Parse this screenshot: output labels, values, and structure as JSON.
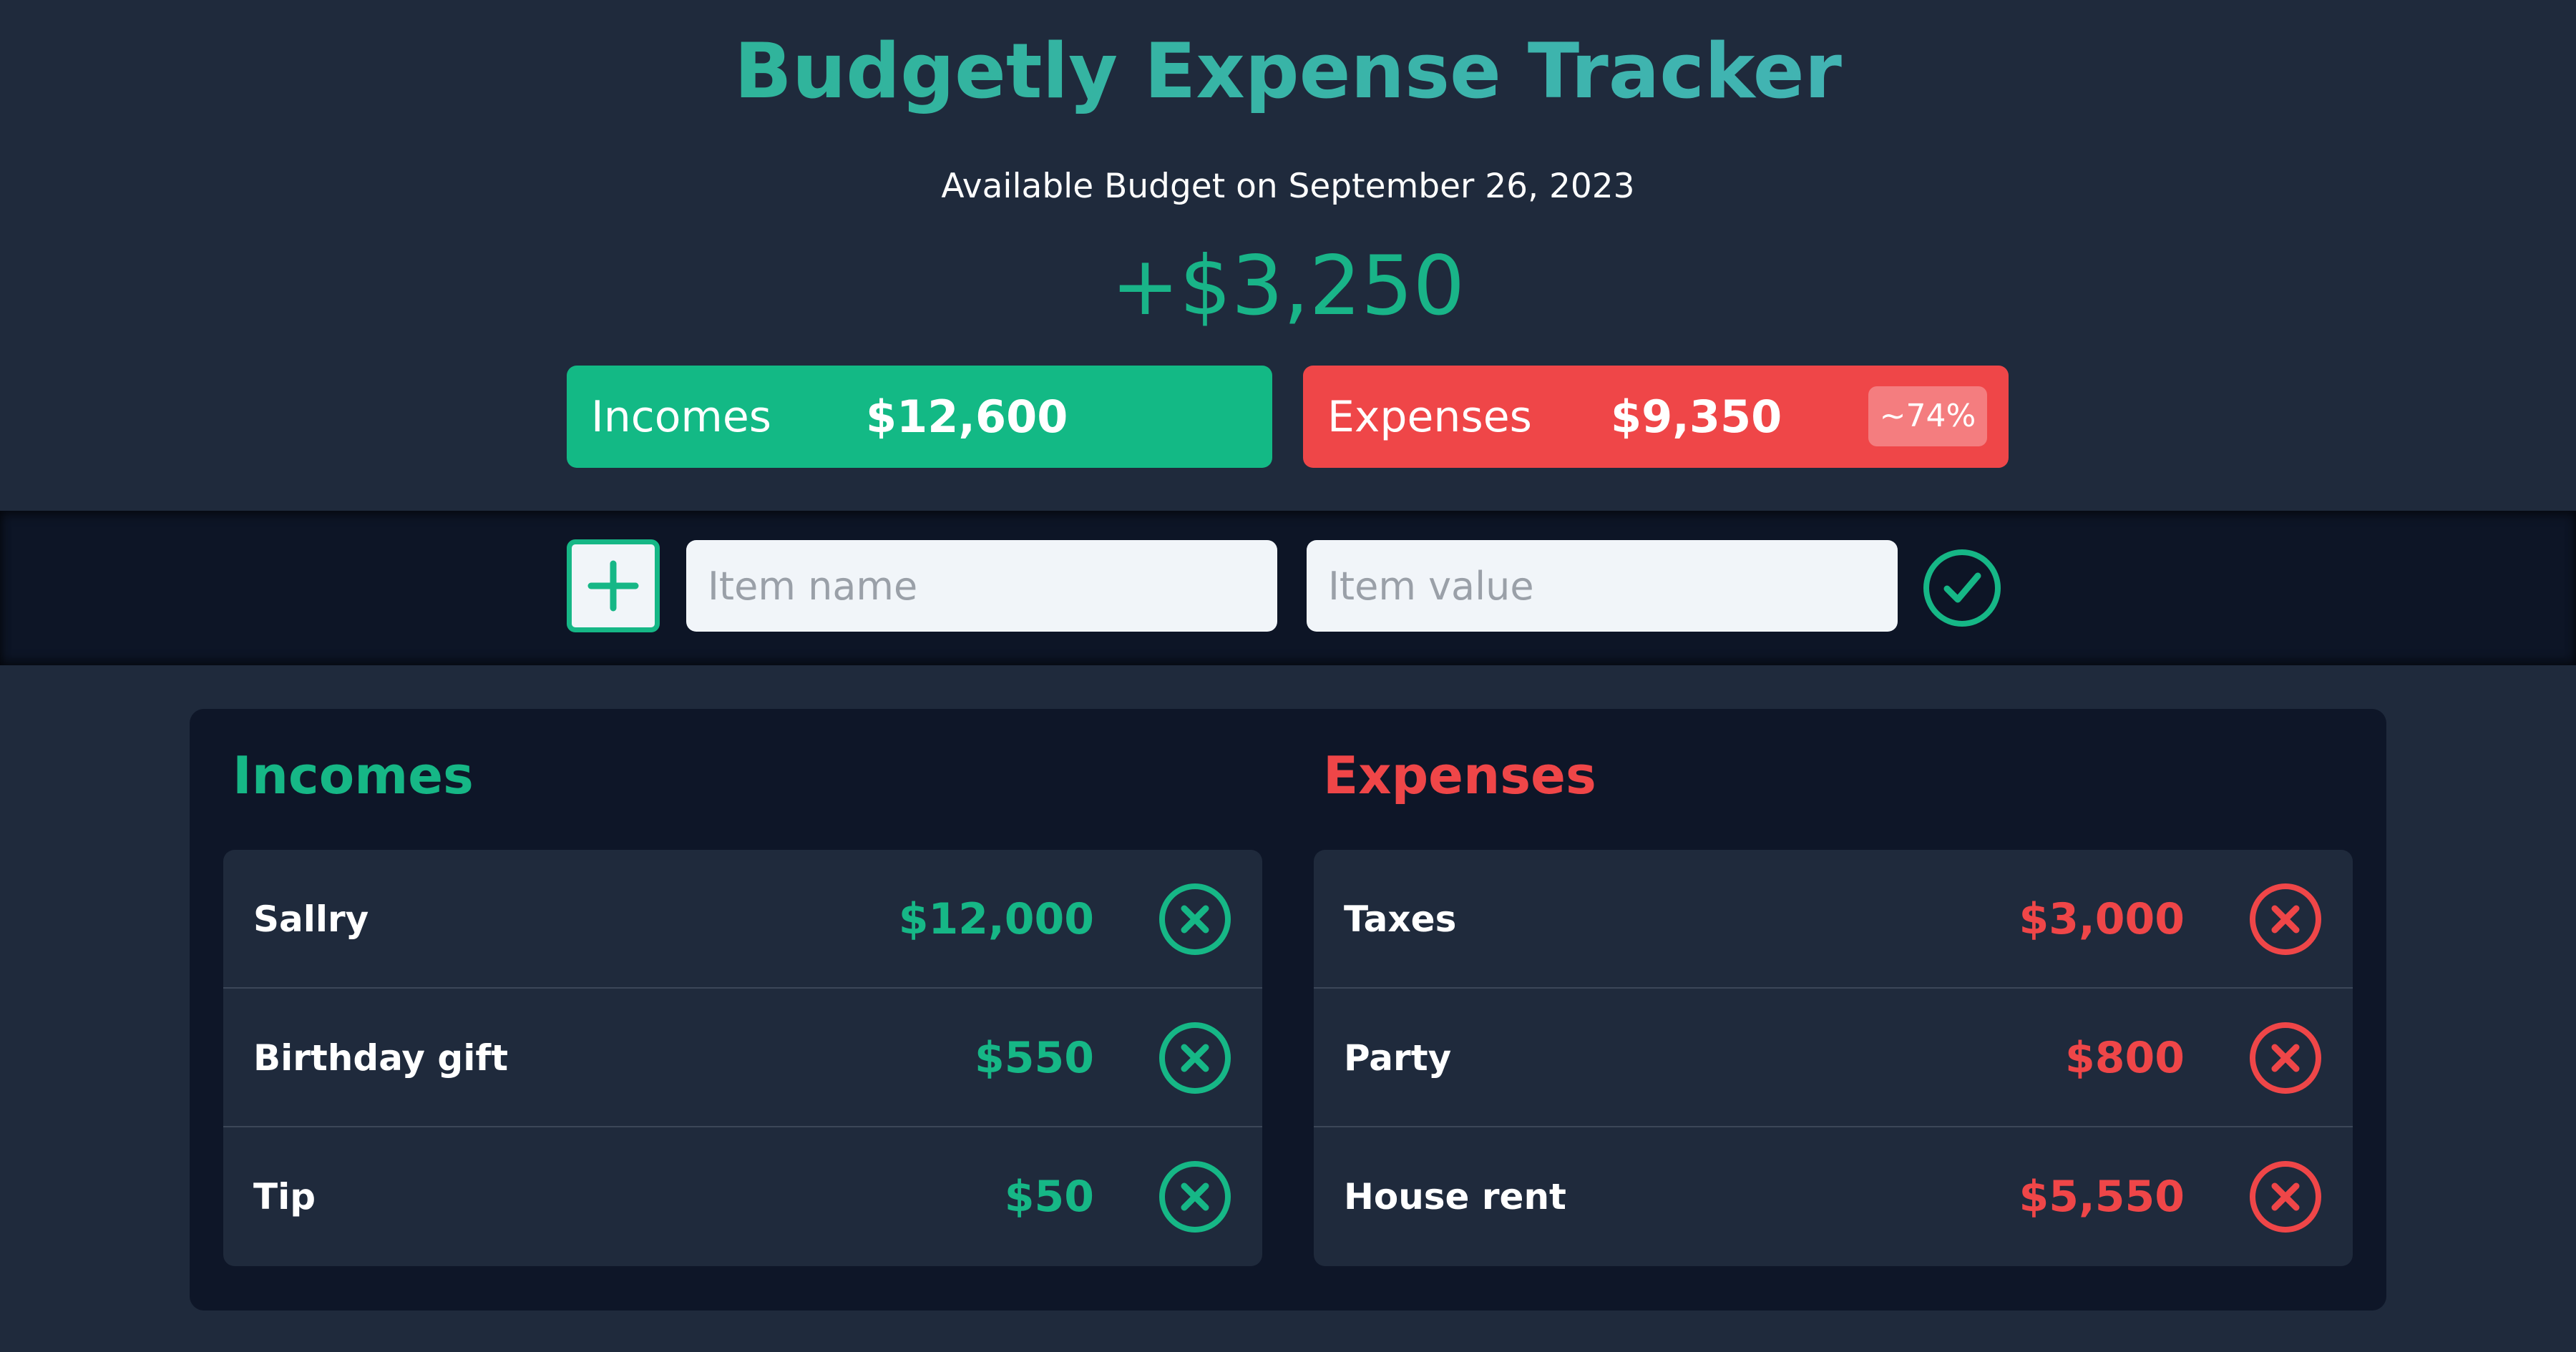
{
  "app": {
    "title": "Budgetly Expense Tracker",
    "subtitle": "Available Budget on September 26, 2023",
    "budget": "+$3,250"
  },
  "summary": {
    "incomes": {
      "label": "Incomes",
      "value": "$12,600"
    },
    "expenses": {
      "label": "Expenses",
      "value": "$9,350",
      "percent": "~74%"
    }
  },
  "form": {
    "name_placeholder": "Item name",
    "value_placeholder": "Item value",
    "add_icon": "plus-icon",
    "confirm_icon": "check-circle-icon"
  },
  "lists": {
    "incomes": {
      "title": "Incomes",
      "items": [
        {
          "name": "Sallry",
          "value": "$12,000"
        },
        {
          "name": "Birthday gift",
          "value": "$550"
        },
        {
          "name": "Tip",
          "value": "$50"
        }
      ]
    },
    "expenses": {
      "title": "Expenses",
      "items": [
        {
          "name": "Taxes",
          "value": "$3,000"
        },
        {
          "name": "Party",
          "value": "$800"
        },
        {
          "name": "House rent",
          "value": "$5,550"
        }
      ]
    },
    "delete_icon": "close-circle-icon"
  },
  "colors": {
    "background": "#1f2a3c",
    "panel": "#0e1628",
    "income": "#16b786",
    "expense": "#ef4648",
    "title_gradient_start": "#22b58a",
    "title_gradient_end": "#4fb3c4"
  }
}
